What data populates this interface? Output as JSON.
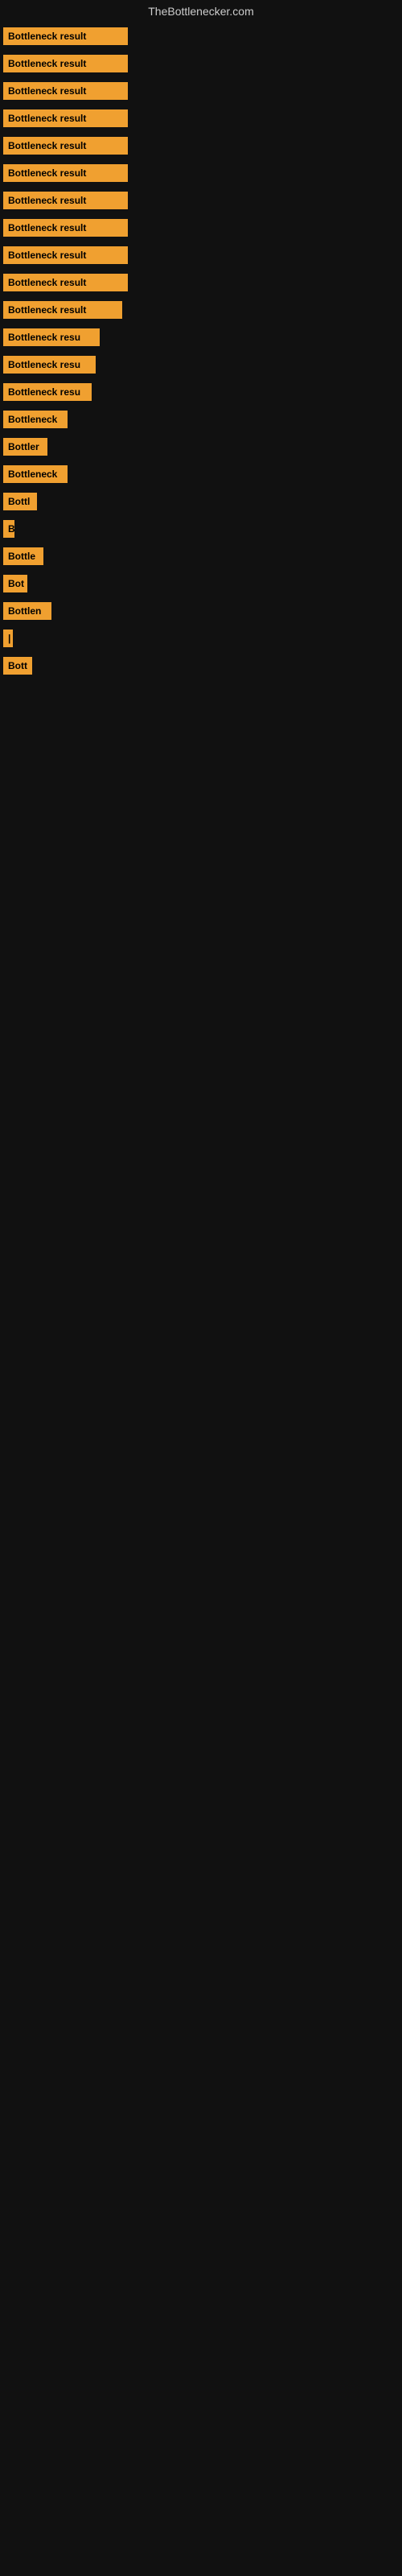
{
  "site": {
    "title": "TheBottlenecker.com"
  },
  "items": [
    {
      "id": 1,
      "label": "Bottleneck result",
      "width": 155
    },
    {
      "id": 2,
      "label": "Bottleneck result",
      "width": 155
    },
    {
      "id": 3,
      "label": "Bottleneck result",
      "width": 155
    },
    {
      "id": 4,
      "label": "Bottleneck result",
      "width": 155
    },
    {
      "id": 5,
      "label": "Bottleneck result",
      "width": 155
    },
    {
      "id": 6,
      "label": "Bottleneck result",
      "width": 155
    },
    {
      "id": 7,
      "label": "Bottleneck result",
      "width": 155
    },
    {
      "id": 8,
      "label": "Bottleneck result",
      "width": 155
    },
    {
      "id": 9,
      "label": "Bottleneck result",
      "width": 155
    },
    {
      "id": 10,
      "label": "Bottleneck result",
      "width": 155
    },
    {
      "id": 11,
      "label": "Bottleneck result",
      "width": 148
    },
    {
      "id": 12,
      "label": "Bottleneck resu",
      "width": 120
    },
    {
      "id": 13,
      "label": "Bottleneck resu",
      "width": 115
    },
    {
      "id": 14,
      "label": "Bottleneck resu",
      "width": 110
    },
    {
      "id": 15,
      "label": "Bottleneck",
      "width": 80
    },
    {
      "id": 16,
      "label": "Bottler",
      "width": 55
    },
    {
      "id": 17,
      "label": "Bottleneck",
      "width": 80
    },
    {
      "id": 18,
      "label": "Bottl",
      "width": 42
    },
    {
      "id": 19,
      "label": "B",
      "width": 14
    },
    {
      "id": 20,
      "label": "Bottle",
      "width": 50
    },
    {
      "id": 21,
      "label": "Bot",
      "width": 30
    },
    {
      "id": 22,
      "label": "Bottlen",
      "width": 60
    },
    {
      "id": 23,
      "label": "|",
      "width": 8
    },
    {
      "id": 24,
      "label": "Bott",
      "width": 36
    }
  ]
}
